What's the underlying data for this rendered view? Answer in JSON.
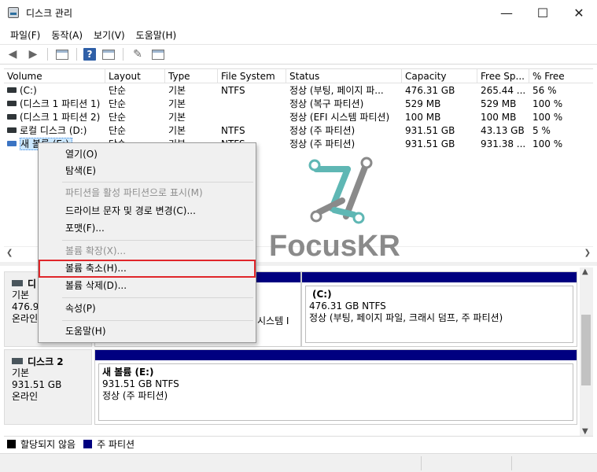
{
  "window": {
    "title": "디스크 관리",
    "min_glyph": "—",
    "max_glyph": "☐",
    "close_glyph": "✕"
  },
  "menu": [
    "파일(F)",
    "동작(A)",
    "보기(V)",
    "도움말(H)"
  ],
  "toolbar": {
    "icons": [
      "back-arrow-icon",
      "forward-arrow-icon",
      "console-tree-icon",
      "help-icon",
      "properties-icon",
      "connect-icon",
      "window-icon"
    ],
    "help_glyph": "?"
  },
  "columns": [
    "Volume",
    "Layout",
    "Type",
    "File System",
    "Status",
    "Capacity",
    "Free Sp...",
    "% Free"
  ],
  "volumes": [
    {
      "name": "(C:)",
      "layout": "단순",
      "type": "기본",
      "fs": "NTFS",
      "status": "정상 (부팅, 페이지 파...",
      "capacity": "476.31 GB",
      "free": "265.44 ...",
      "pct": "56 %"
    },
    {
      "name": "(디스크 1 파티션 1)",
      "layout": "단순",
      "type": "기본",
      "fs": "",
      "status": "정상 (복구 파티션)",
      "capacity": "529 MB",
      "free": "529 MB",
      "pct": "100 %"
    },
    {
      "name": "(디스크 1 파티션 2)",
      "layout": "단순",
      "type": "기본",
      "fs": "",
      "status": "정상 (EFI 시스템 파티션)",
      "capacity": "100 MB",
      "free": "100 MB",
      "pct": "100 %"
    },
    {
      "name": "로컬 디스크 (D:)",
      "layout": "단순",
      "type": "기본",
      "fs": "NTFS",
      "status": "정상 (주 파티션)",
      "capacity": "931.51 GB",
      "free": "43.13 GB",
      "pct": "5 %"
    },
    {
      "name": "새 볼륨 (E:)",
      "layout": "단순",
      "type": "기본",
      "fs": "NTFS",
      "status": "정상 (주 파티션)",
      "capacity": "931.51 GB",
      "free": "931.38 ...",
      "pct": "100 %"
    }
  ],
  "context_menu": {
    "open": "열기(O)",
    "explore": "탐색(E)",
    "mark_active": "파티션을 활성 파티션으로 표시(M)",
    "change_letter": "드라이브 문자 및 경로 변경(C)...",
    "format": "포맷(F)...",
    "extend": "볼륨 확장(X)...",
    "shrink": "볼륨 축소(H)...",
    "delete": "볼륨 삭제(D)...",
    "properties": "속성(P)",
    "help": "도움말(H)"
  },
  "disk1": {
    "name": "디",
    "type": "기본",
    "size": "476.92",
    "state": "온라인",
    "sys_part_text": "시스템 I",
    "c_name": "(C:)",
    "c_size": "476.31 GB NTFS",
    "c_status": "정상 (부팅, 페이지 파일, 크래시 덤프, 주 파티션)"
  },
  "disk2": {
    "name": "디스크 2",
    "type": "기본",
    "size": "931.51 GB",
    "state": "온라인",
    "e_name": "새 볼륨  (E:)",
    "e_size": "931.51 GB NTFS",
    "e_status": "정상 (주 파티션)"
  },
  "legend": {
    "unallocated": "할당되지 않음",
    "primary": "주 파티션"
  },
  "watermark": {
    "text": "FocusKR"
  },
  "colors": {
    "primary_partition": "#000080",
    "selection": "#cce8ff",
    "highlight_red": "#e0262a",
    "watermark_teal": "#5fb7b4"
  }
}
